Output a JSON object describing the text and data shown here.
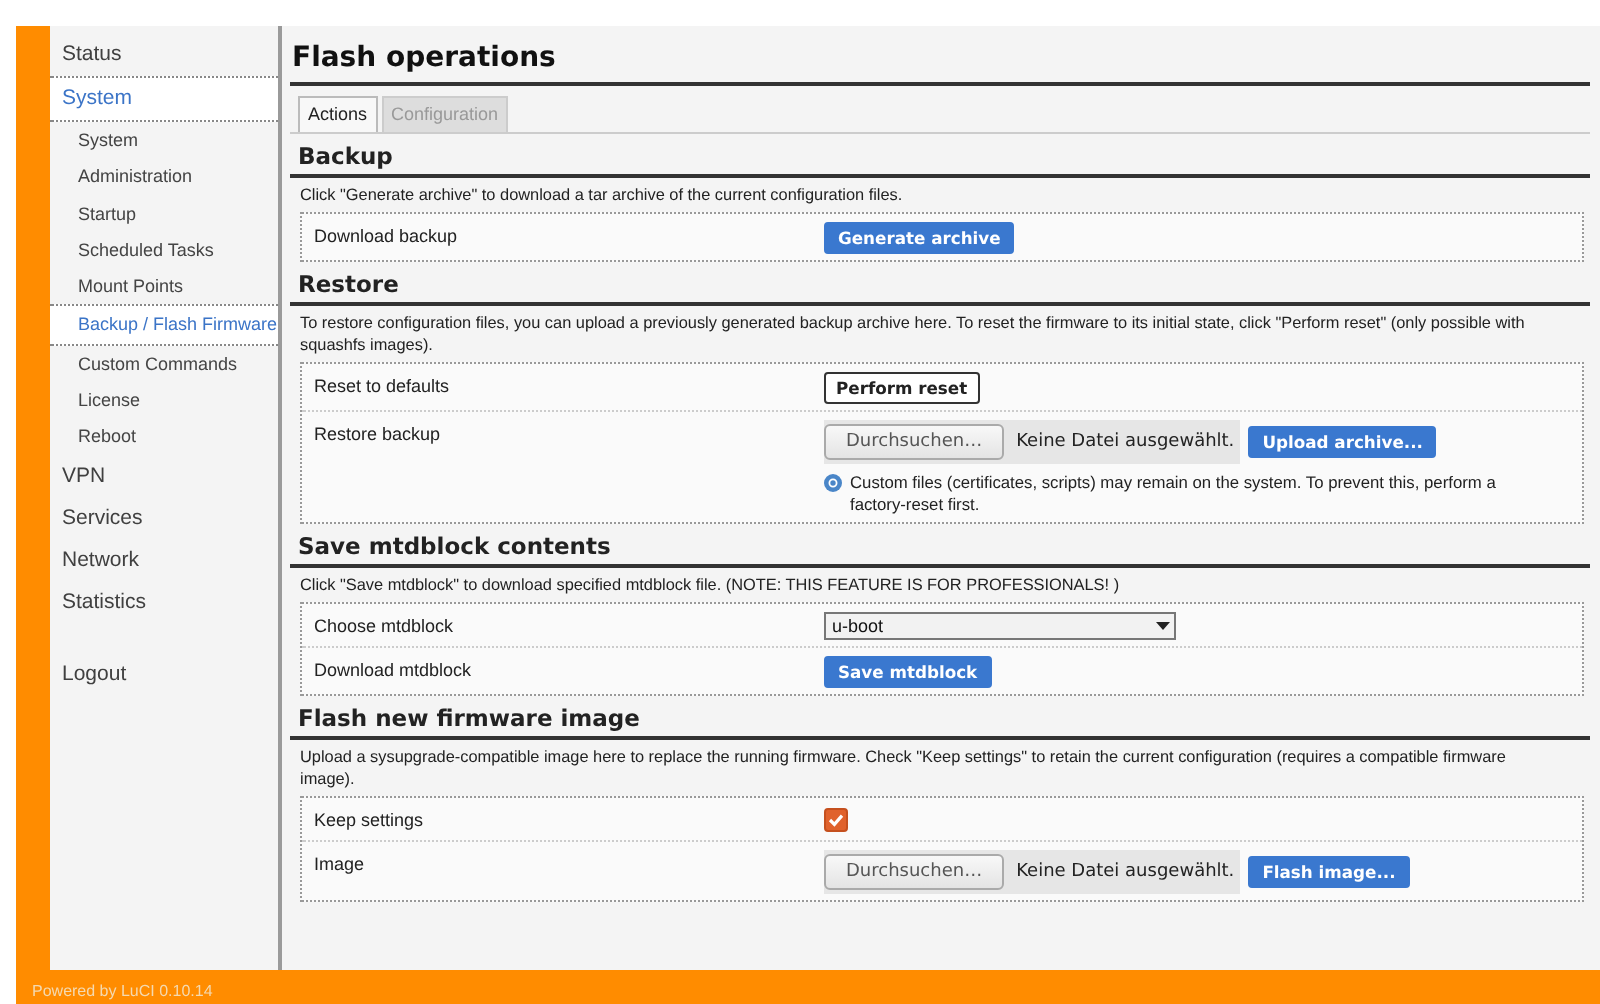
{
  "sidebar": {
    "items": [
      {
        "label": "Status",
        "selected": false
      },
      {
        "label": "System",
        "selected": true,
        "children": [
          {
            "label": "System",
            "selected": false
          },
          {
            "label": "Administration",
            "selected": false
          },
          {
            "label": "Startup",
            "selected": false
          },
          {
            "label": "Scheduled Tasks",
            "selected": false
          },
          {
            "label": "Mount Points",
            "selected": false
          },
          {
            "label": "Backup / Flash Firmware",
            "selected": true
          },
          {
            "label": "Custom Commands",
            "selected": false
          },
          {
            "label": "License",
            "selected": false
          },
          {
            "label": "Reboot",
            "selected": false
          }
        ]
      },
      {
        "label": "VPN",
        "selected": false
      },
      {
        "label": "Services",
        "selected": false
      },
      {
        "label": "Network",
        "selected": false
      },
      {
        "label": "Statistics",
        "selected": false
      }
    ],
    "logout": "Logout"
  },
  "page": {
    "title": "Flash operations",
    "tabs": [
      {
        "label": "Actions",
        "selected": true
      },
      {
        "label": "Configuration",
        "selected": false
      }
    ]
  },
  "sections": [
    {
      "title": "Backup",
      "description": "Click \"Generate archive\" to download a tar archive of the current configuration files.",
      "rows": [
        {
          "label": "Download backup",
          "controls": [
            {
              "kind": "button",
              "primary": true,
              "label": "Generate archive"
            }
          ]
        }
      ]
    },
    {
      "title": "Restore",
      "description": "To restore configuration files, you can upload a previously generated backup archive here. To reset the firmware to its initial state, click \"Perform reset\" (only possible with squashfs images).",
      "rows": [
        {
          "label": "Reset to defaults",
          "controls": [
            {
              "kind": "button",
              "primary": false,
              "label": "Perform reset"
            }
          ]
        },
        {
          "label": "Restore backup",
          "controls": [
            {
              "kind": "file",
              "button": "Durchsuchen…",
              "status": "Keine Datei ausgewählt."
            },
            {
              "kind": "button",
              "primary": true,
              "label": "Upload archive..."
            }
          ],
          "hint": "Custom files (certificates, scripts) may remain on the system. To prevent this, perform a factory-reset first."
        }
      ]
    },
    {
      "title": "Save mtdblock contents",
      "description": "Click \"Save mtdblock\" to download specified mtdblock file. (NOTE: THIS FEATURE IS FOR PROFESSIONALS! )",
      "rows": [
        {
          "label": "Choose mtdblock",
          "controls": [
            {
              "kind": "select",
              "value": "u-boot"
            }
          ]
        },
        {
          "label": "Download mtdblock",
          "controls": [
            {
              "kind": "button",
              "primary": true,
              "label": "Save mtdblock"
            }
          ]
        }
      ]
    },
    {
      "title": "Flash new firmware image",
      "description": "Upload a sysupgrade-compatible image here to replace the running firmware. Check \"Keep settings\" to retain the current configuration (requires a compatible firmware image).",
      "rows": [
        {
          "label": "Keep settings",
          "controls": [
            {
              "kind": "checkbox",
              "checked": true
            }
          ]
        },
        {
          "label": "Image",
          "controls": [
            {
              "kind": "file",
              "button": "Durchsuchen…",
              "status": "Keine Datei ausgewählt."
            },
            {
              "kind": "button",
              "primary": true,
              "label": "Flash image..."
            }
          ]
        }
      ]
    }
  ],
  "footer": "Powered by LuCI 0.10.14"
}
